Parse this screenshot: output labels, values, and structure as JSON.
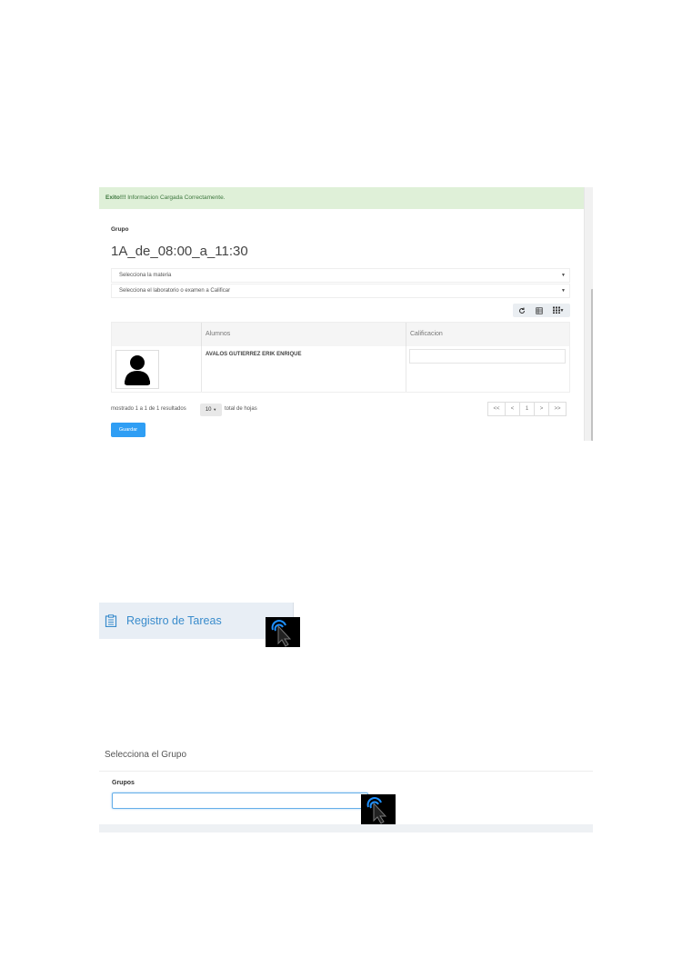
{
  "panel1": {
    "alert": {
      "strong": "Exito!!!",
      "text": " Informacion Cargada Correctamente."
    },
    "group_label": "Grupo",
    "group_name": "1A_de_08:00_a_11:30",
    "select_materia": "Selecciona la materia",
    "select_examen": "Selecciona el laboratorio o examen a Calificar",
    "toolbar": {
      "refresh_icon": "refresh-icon",
      "toggle_icon": "toggle-view-icon",
      "columns_icon": "columns-icon"
    },
    "table": {
      "headers": [
        "",
        "Alumnos",
        "Calificacion"
      ],
      "rows": [
        {
          "avatar_icon": "user-avatar-icon",
          "alumno": "AVALOS GUTIERREZ ERIK ENRIQUE",
          "calificacion": ""
        }
      ]
    },
    "footer": {
      "showing": "mostrado 1 a 1 de 1 resultados",
      "page_size": "10",
      "total": "total de hojas",
      "pager": [
        "<<",
        "<",
        "1",
        ">",
        ">>"
      ]
    },
    "save_label": "Guardar"
  },
  "panel2": {
    "icon": "clipboard-icon",
    "label": "Registro de Tareas"
  },
  "panel3": {
    "title": "Selecciona el Grupo",
    "field_label": "Grupos",
    "field_value": ""
  },
  "colors": {
    "accent": "#2f9ef4",
    "success_bg": "#dff0d8",
    "menu_bg": "#e8eef5",
    "menu_text": "#3a8ccc",
    "focus": "#66afe9"
  }
}
